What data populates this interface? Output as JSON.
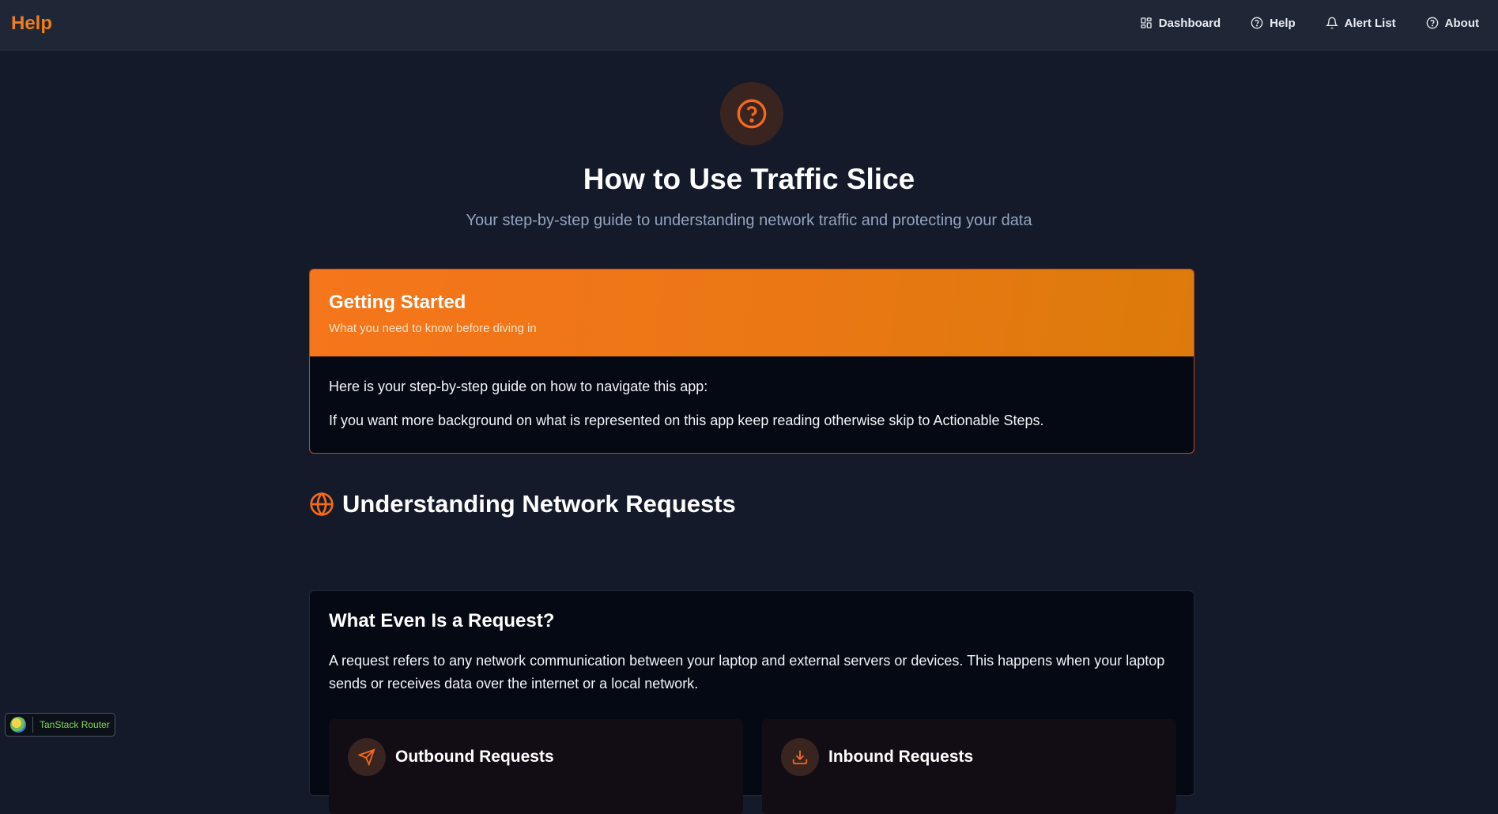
{
  "header": {
    "brand": "Help",
    "nav": [
      {
        "label": "Dashboard",
        "icon": "dashboard-grid-icon"
      },
      {
        "label": "Help",
        "icon": "help-circle-icon"
      },
      {
        "label": "Alert List",
        "icon": "bell-icon"
      },
      {
        "label": "About",
        "icon": "help-circle-icon"
      }
    ]
  },
  "hero": {
    "icon": "help-circle-icon",
    "title": "How to Use Traffic Slice",
    "subtitle": "Your step-by-step guide to understanding network traffic and protecting your data"
  },
  "getting_started": {
    "title": "Getting Started",
    "subtitle": "What you need to know before diving in",
    "paragraphs": [
      "Here is your step-by-step guide on how to navigate this app:",
      "If you want more background on what is represented on this app keep reading otherwise skip to Actionable Steps."
    ]
  },
  "network_section": {
    "icon": "globe-icon",
    "title": "Understanding Network Requests",
    "request_card": {
      "title": "What Even Is a Request?",
      "description": "A request refers to any network communication between your laptop and external servers or devices. This happens when your laptop sends or receives data over the internet or a local network.",
      "types": [
        {
          "title": "Outbound Requests",
          "icon": "send-icon"
        },
        {
          "title": "Inbound Requests",
          "icon": "download-icon"
        }
      ]
    }
  },
  "devtools": {
    "label": "TanStack Router"
  },
  "colors": {
    "accent": "#f07c1b",
    "background": "#141a2a",
    "header": "#1f2737",
    "card": "#050913"
  }
}
